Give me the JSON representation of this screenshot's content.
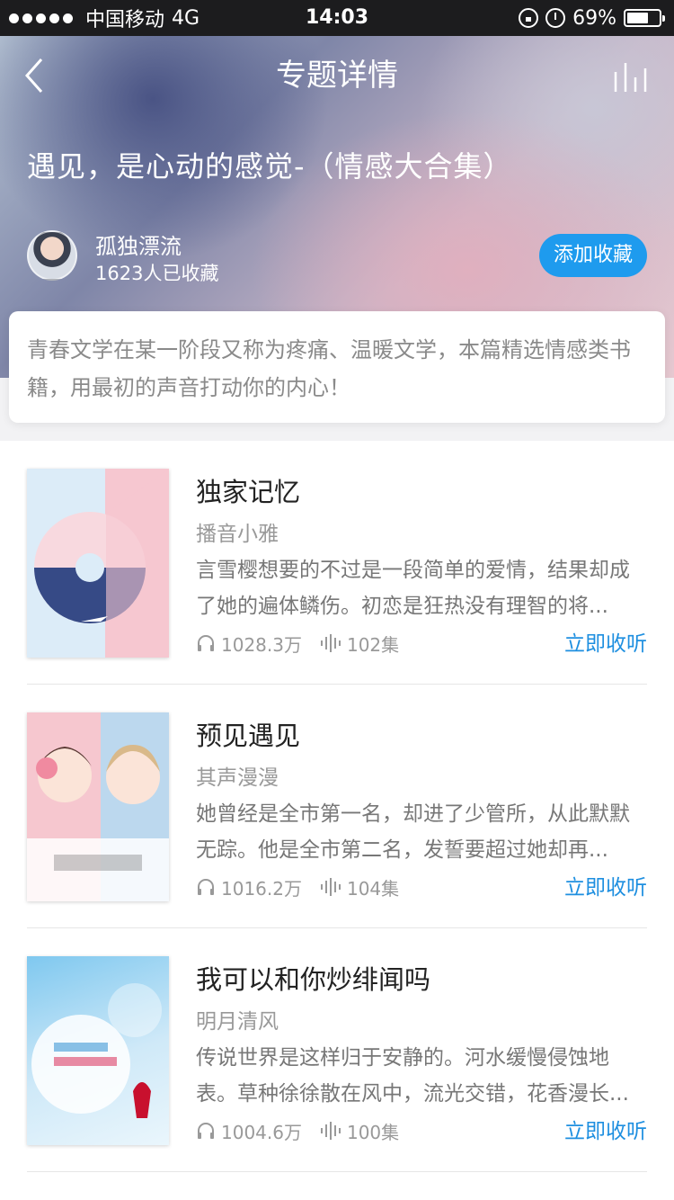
{
  "status_bar": {
    "carrier": "中国移动",
    "network": "4G",
    "time": "14:03",
    "battery": "69%",
    "battery_level": 0.69
  },
  "nav": {
    "title": "专题详情",
    "back_icon": "chevron-left-icon",
    "chart_icon": "bar-chart-icon"
  },
  "topic": {
    "title": "遇见，是心动的感觉-（情感大合集）",
    "author": "孤独漂流",
    "favorites": "1623人已收藏",
    "favorite_button": "添加收藏",
    "description": "青春文学在某一阶段又称为疼痛、温暖文学，本篇精选情感类书籍，用最初的声音打动你的内心！"
  },
  "books": [
    {
      "title": "独家记忆",
      "author": "播音小雅",
      "description": "言雪樱想要的不过是一段简单的爱情，结果却成了她的遍体鳞伤。初恋是狂热没有理智的将...",
      "plays": "1028.3万",
      "episodes": "102集",
      "action": "立即收听"
    },
    {
      "title": "预见遇见",
      "author": "其声漫漫",
      "description": "她曾经是全市第一名，却进了少管所，从此默默无踪。他是全市第二名，发誓要超过她却再...",
      "plays": "1016.2万",
      "episodes": "104集",
      "action": "立即收听"
    },
    {
      "title": "我可以和你炒绯闻吗",
      "author": "明月清风",
      "description": "传说世界是这样归于安静的。河水缓慢侵蚀地表。草种徐徐散在风中，流光交错，花香漫长...",
      "plays": "1004.6万",
      "episodes": "100集",
      "action": "立即收听"
    }
  ],
  "colors": {
    "accent": "#1e9bee",
    "link": "#1e8fe0"
  }
}
